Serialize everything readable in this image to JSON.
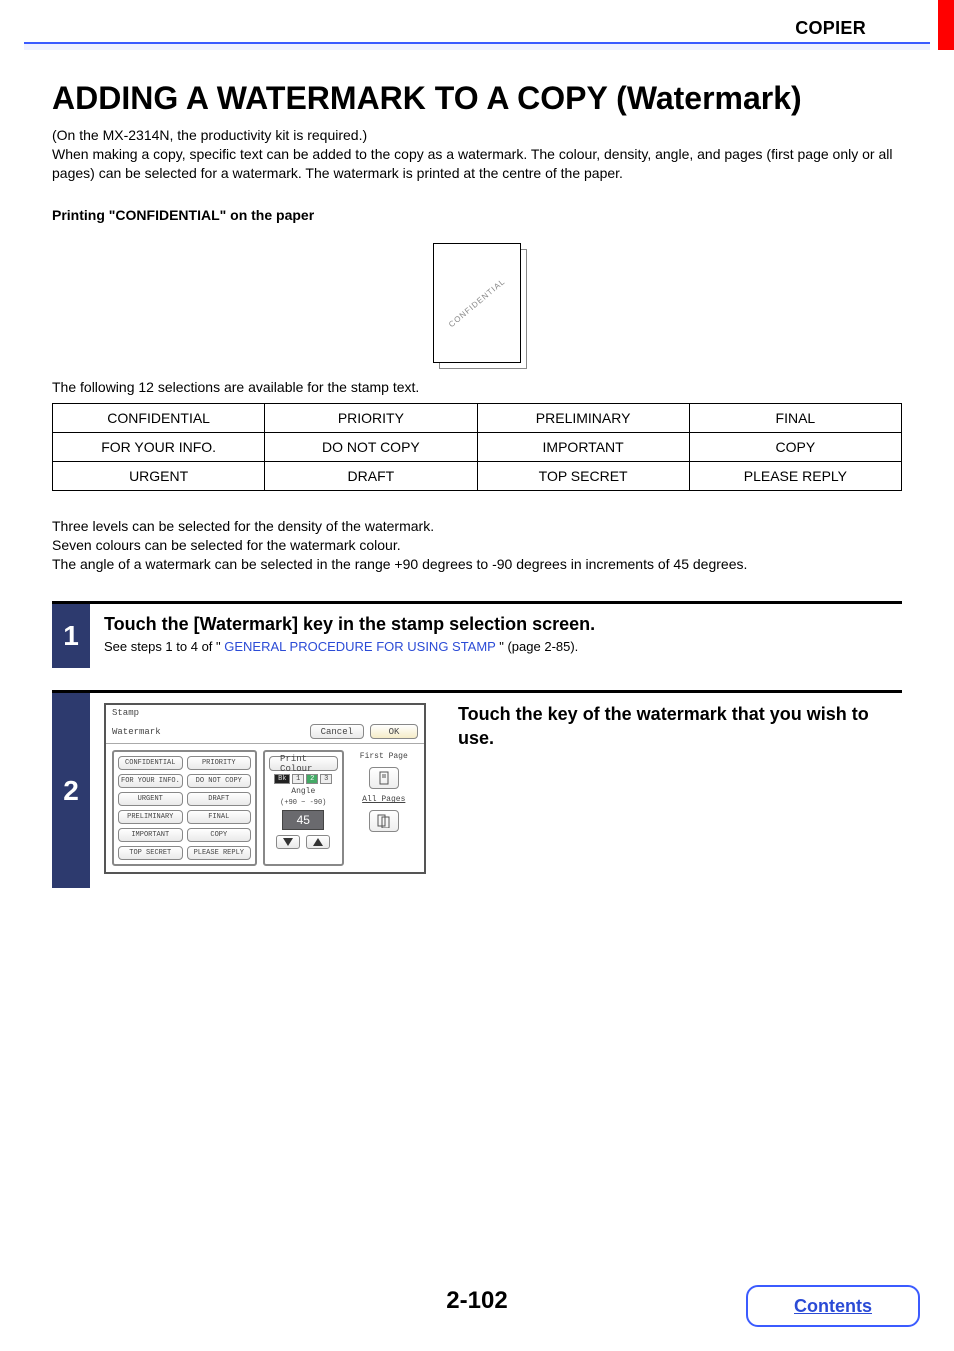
{
  "header": {
    "section": "COPIER"
  },
  "title": "ADDING A WATERMARK TO A COPY (Watermark)",
  "intro": {
    "note": "(On the MX-2314N, the productivity kit is required.)",
    "body": "When making a copy, specific text can be added to the copy as a watermark. The colour, density, angle, and pages (first page only or all pages) can be selected for a watermark. The watermark is printed at the centre of the paper."
  },
  "example": {
    "heading": "Printing \"CONFIDENTIAL\" on the paper",
    "illustration_text": "CONFIDENTIAL"
  },
  "selections": {
    "intro": "The following 12 selections are available for the stamp text.",
    "texts": [
      "CONFIDENTIAL",
      "PRIORITY",
      "PRELIMINARY",
      "FINAL",
      "FOR YOUR INFO.",
      "DO NOT COPY",
      "IMPORTANT",
      "COPY",
      "URGENT",
      "DRAFT",
      "TOP SECRET",
      "PLEASE REPLY"
    ]
  },
  "notes": {
    "density": "Three levels can be selected for the density of the watermark.",
    "colour": "Seven colours can be selected for the watermark colour.",
    "angle": "The angle of a watermark can be selected in the range +90 degrees to -90 degrees in increments of 45 degrees."
  },
  "steps": [
    {
      "num": "1",
      "title": "Touch the [Watermark] key in the stamp selection screen.",
      "see_prefix": "See steps 1 to 4 of \"",
      "see_link": "GENERAL PROCEDURE FOR USING STAMP",
      "see_suffix": "\" (page 2-85)."
    },
    {
      "num": "2",
      "title": "Touch the key of the watermark that you wish to use."
    }
  ],
  "panel": {
    "title": "Stamp",
    "subtitle": "Watermark",
    "cancel": "Cancel",
    "ok": "OK",
    "print_colour": "Print Colour",
    "options": [
      "CONFIDENTIAL",
      "PRIORITY",
      "FOR YOUR INFO.",
      "DO NOT COPY",
      "URGENT",
      "DRAFT",
      "PRELIMINARY",
      "FINAL",
      "IMPORTANT",
      "COPY",
      "TOP SECRET",
      "PLEASE REPLY"
    ],
    "density": {
      "bk": "Bk",
      "levels": [
        "1",
        "2",
        "3"
      ]
    },
    "angle": {
      "label": "Angle",
      "range": "(+90 ~ -90)",
      "value": "45"
    },
    "pages": {
      "first": "First Page",
      "all": "All Pages"
    }
  },
  "footer": {
    "page": "2-102",
    "contents": "Contents"
  }
}
